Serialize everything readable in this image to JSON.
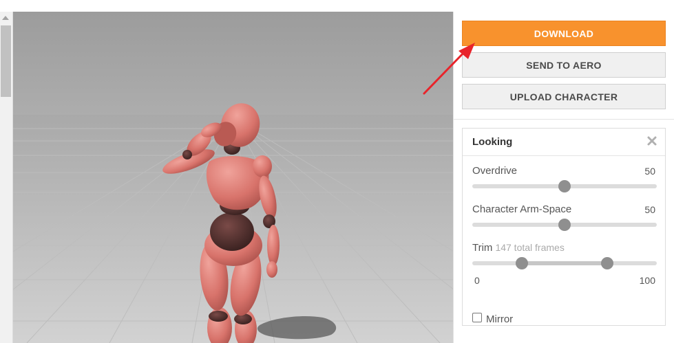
{
  "actions": {
    "download_label": "DOWNLOAD",
    "send_label": "SEND TO AERO",
    "upload_label": "UPLOAD CHARACTER"
  },
  "card": {
    "title": "Looking",
    "overdrive": {
      "label": "Overdrive",
      "value": "50",
      "level": 0.5
    },
    "arm_space": {
      "label": "Character Arm-Space",
      "value": "50",
      "level": 0.5
    },
    "trim": {
      "label": "Trim",
      "subtitle": "147 total frames",
      "min": "0",
      "max": "100",
      "start": 0.27,
      "end": 0.73
    },
    "mirror_label": "Mirror"
  },
  "colors": {
    "download": "#f8922d",
    "arrow": "#e8242b",
    "character": "#e07870"
  }
}
